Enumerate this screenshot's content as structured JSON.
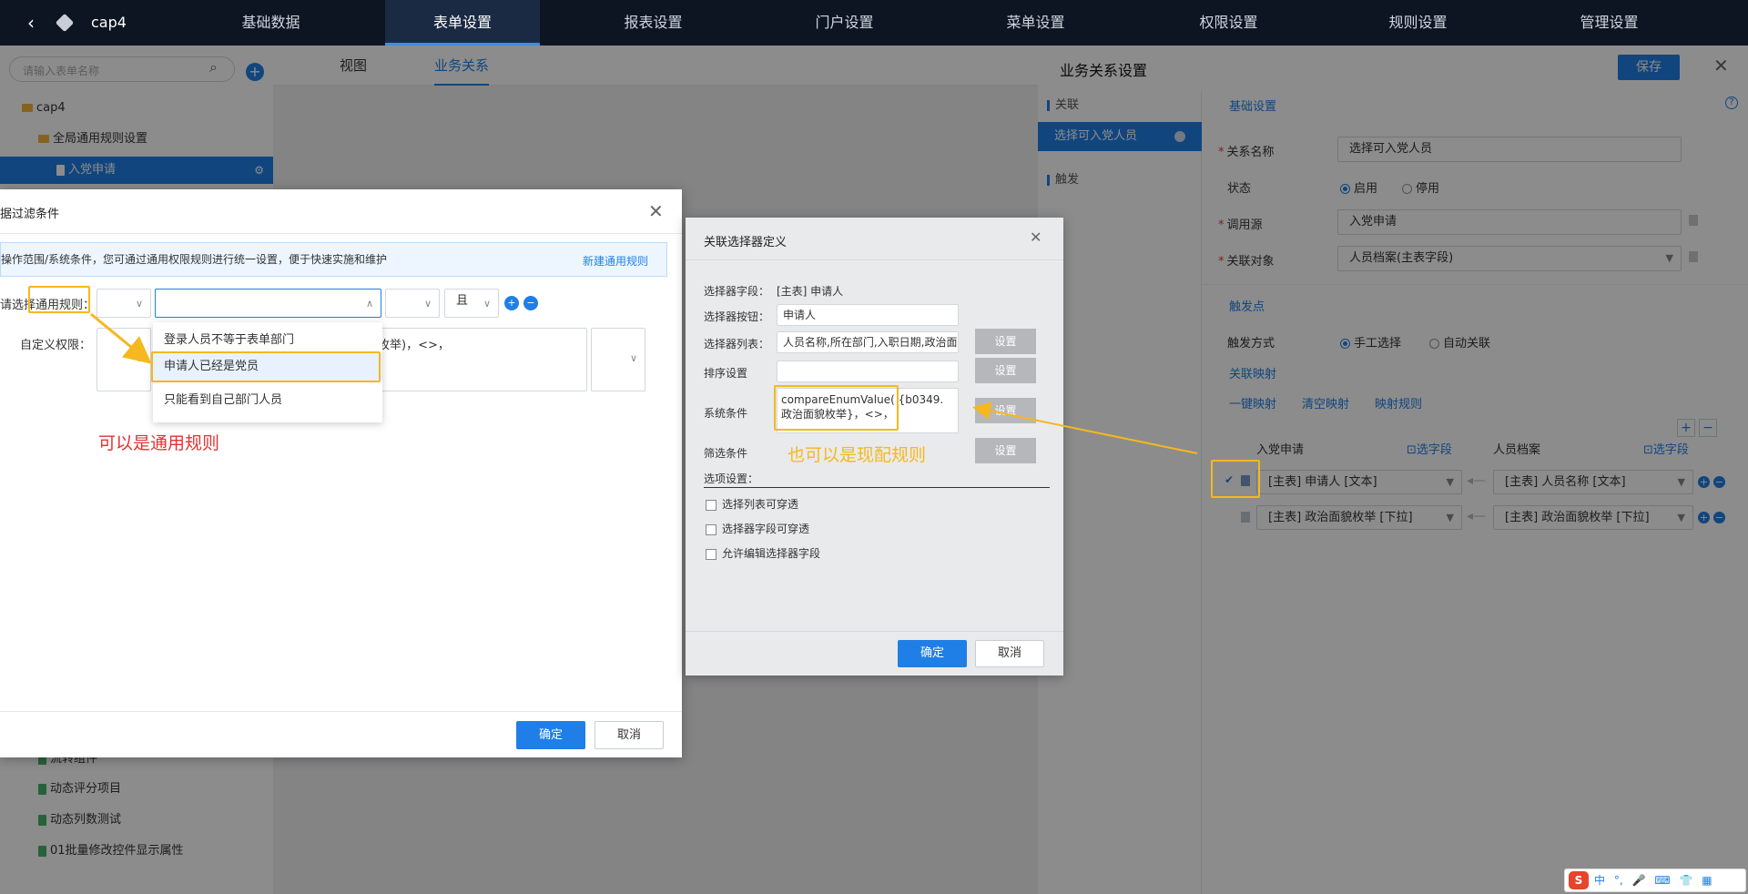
{
  "topbar": {
    "app_name": "cap4",
    "tabs": [
      "基础数据",
      "表单设置",
      "报表设置",
      "门户设置",
      "菜单设置",
      "权限设置",
      "规则设置",
      "管理设置"
    ],
    "active_tab": "表单设置"
  },
  "left_panel": {
    "search_placeholder": "请输入表单名称",
    "tree": [
      {
        "label": "cap4",
        "type": "folder"
      },
      {
        "label": "全局通用规则设置",
        "type": "folder"
      },
      {
        "label": "入党申请",
        "type": "doc",
        "selected": true
      },
      {
        "label": "流转组件",
        "type": "doc"
      },
      {
        "label": "动态评分项目",
        "type": "doc"
      },
      {
        "label": "动态列数测试",
        "type": "doc"
      },
      {
        "label": "01批量修改控件显示属性",
        "type": "doc"
      }
    ]
  },
  "view_tabs": [
    "视图",
    "业务关系"
  ],
  "right_panel": {
    "title": "业务关系设置",
    "save": "保存",
    "side": {
      "section_relation": "关联",
      "item_active": "选择可入党人员",
      "section_trigger": "触发"
    },
    "basic_title": "基础设置",
    "help": "?",
    "relation_name_label": "关系名称",
    "relation_name_value": "选择可入党人员",
    "status_label": "状态",
    "status_on": "启用",
    "status_off": "停用",
    "source_label": "调用源",
    "source_value": "入党申请",
    "target_label": "关联对象",
    "target_value": "人员档案(主表字段)",
    "trigger_title": "触发点",
    "trigger_mode_label": "触发方式",
    "trigger_manual": "手工选择",
    "trigger_auto": "自动关联",
    "mapping_title": "关联映射",
    "mapping_links": [
      "一键映射",
      "清空映射",
      "映射规则"
    ],
    "col_left": "入党申请",
    "col_right": "人员档案",
    "choose_field": "选字段",
    "rows": [
      {
        "left": "[主表] 申请人 [文本]",
        "right": "[主表] 人员名称 [文本]"
      },
      {
        "left": "[主表] 政治面貌枚举 [下拉]",
        "right": "[主表] 政治面貌枚举 [下拉]"
      }
    ]
  },
  "dialog1": {
    "title": "据过滤条件",
    "info": "操作范围/系统条件，您可通过通用权限规则进行统一设置，便于快速实施和维护",
    "new_rule": "新建通用规则",
    "choose_rule_label": "请选择通用规则：",
    "conj": "且",
    "custom_label": "自定义权限：",
    "custom_text": "枚举)，<>，",
    "dropdown": [
      "登录人员不等于表单部门",
      "申请人已经是党员",
      "只能看到自己部门人员"
    ],
    "annotation": "可以是通用规则",
    "ok": "确定",
    "cancel": "取消"
  },
  "dialog2": {
    "title": "关联选择器定义",
    "field_label": "选择器字段：",
    "field_value": "[主表] 申请人",
    "button_label": "选择器按钮：",
    "button_value": "申请人",
    "list_label": "选择器列表：",
    "list_value": "人员名称,所在部门,入职日期,政治面",
    "sort_label": "排序设置",
    "system_label": "系统条件",
    "system_value": "compareEnumValue( {b0349.政治面貌枚举}，<>，",
    "filter_label": "筛选条件",
    "set": "设置",
    "annotation": "也可以是现配规则",
    "options_label": "选项设置：",
    "options": [
      "选择列表可穿透",
      "选择器字段可穿透",
      "允许编辑选择器字段"
    ],
    "ok": "确定",
    "cancel": "取消"
  },
  "ime": {
    "lang": "中"
  }
}
